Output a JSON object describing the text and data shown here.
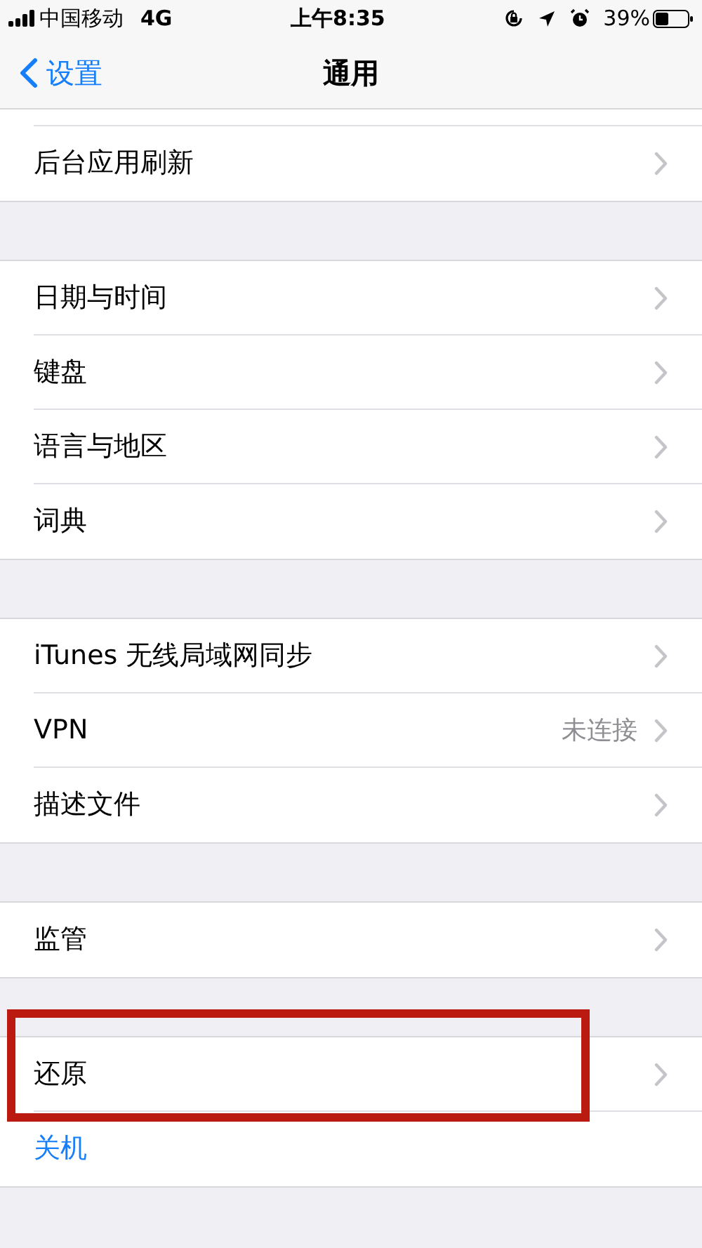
{
  "status_bar": {
    "carrier": "中国移动",
    "network": "4G",
    "time": "上午8:35",
    "battery": "39%"
  },
  "nav_bar": {
    "back": "设置",
    "title": "通用"
  },
  "groups": [
    {
      "rows": [
        {
          "kind": "nav",
          "label": "后台应用刷新",
          "highlighted": false
        }
      ]
    },
    {
      "rows": [
        {
          "kind": "nav",
          "label": "日期与时间",
          "highlighted": false
        },
        {
          "kind": "nav",
          "label": "键盘",
          "highlighted": false
        },
        {
          "kind": "nav",
          "label": "语言与地区",
          "highlighted": false
        },
        {
          "kind": "nav",
          "label": "词典",
          "highlighted": false
        }
      ]
    },
    {
      "rows": [
        {
          "kind": "nav",
          "label": "iTunes 无线局域网同步",
          "highlighted": false
        },
        {
          "kind": "nav",
          "label": "VPN",
          "value": "未连接",
          "highlighted": false
        },
        {
          "kind": "nav",
          "label": "描述文件",
          "highlighted": false
        }
      ]
    },
    {
      "rows": [
        {
          "kind": "nav",
          "label": "监管",
          "highlighted": false
        }
      ]
    },
    {
      "rows": [
        {
          "kind": "nav",
          "label": "还原",
          "highlighted": true
        },
        {
          "kind": "action",
          "label": "关机",
          "highlighted": false
        }
      ]
    }
  ]
}
